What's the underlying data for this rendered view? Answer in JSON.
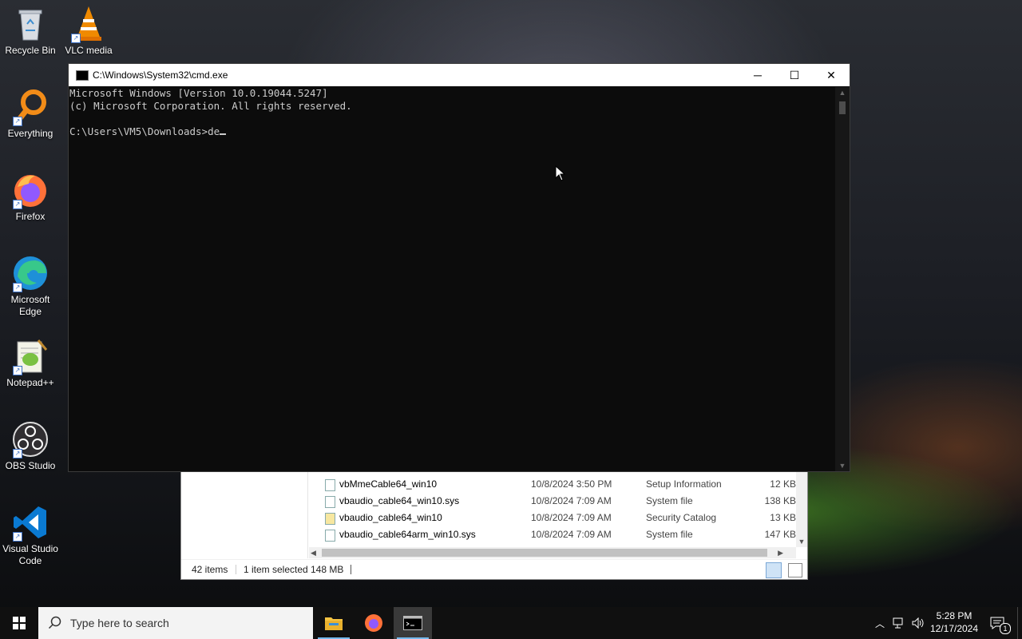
{
  "desktop": {
    "icons": [
      {
        "label": "Recycle Bin"
      },
      {
        "label": "VLC media"
      },
      {
        "label": "Everything"
      },
      {
        "label": "Firefox"
      },
      {
        "label": "Microsoft Edge"
      },
      {
        "label": "Notepad++"
      },
      {
        "label": "OBS Studio"
      },
      {
        "label": "Visual Studio Code"
      }
    ]
  },
  "cmd": {
    "title": "C:\\Windows\\System32\\cmd.exe",
    "lines": [
      "Microsoft Windows [Version 10.0.19044.5247]",
      "(c) Microsoft Corporation. All rights reserved.",
      "",
      "C:\\Users\\VM5\\Downloads>de"
    ],
    "minimize": "─",
    "maximize": "☐",
    "close": "✕"
  },
  "explorer": {
    "files": [
      {
        "name": "vbMmeCable64_win10",
        "date": "10/8/2024 3:50 PM",
        "type": "Setup Information",
        "size": "12 KB"
      },
      {
        "name": "vbaudio_cable64_win10.sys",
        "date": "10/8/2024 7:09 AM",
        "type": "System file",
        "size": "138 KB"
      },
      {
        "name": "vbaudio_cable64_win10",
        "date": "10/8/2024 7:09 AM",
        "type": "Security Catalog",
        "size": "13 KB"
      },
      {
        "name": "vbaudio_cable64arm_win10.sys",
        "date": "10/8/2024 7:09 AM",
        "type": "System file",
        "size": "147 KB"
      }
    ],
    "status": {
      "items": "42 items",
      "selected": "1 item selected",
      "size": "148 MB"
    }
  },
  "taskbar": {
    "search_placeholder": "Type here to search",
    "time": "5:28 PM",
    "date": "12/17/2024",
    "notification_count": "1"
  },
  "colors": {
    "console_bg": "#0c0c0c",
    "console_text": "#cccccc",
    "taskbar_bg": "#101010",
    "active_underline": "#76b9ed"
  }
}
